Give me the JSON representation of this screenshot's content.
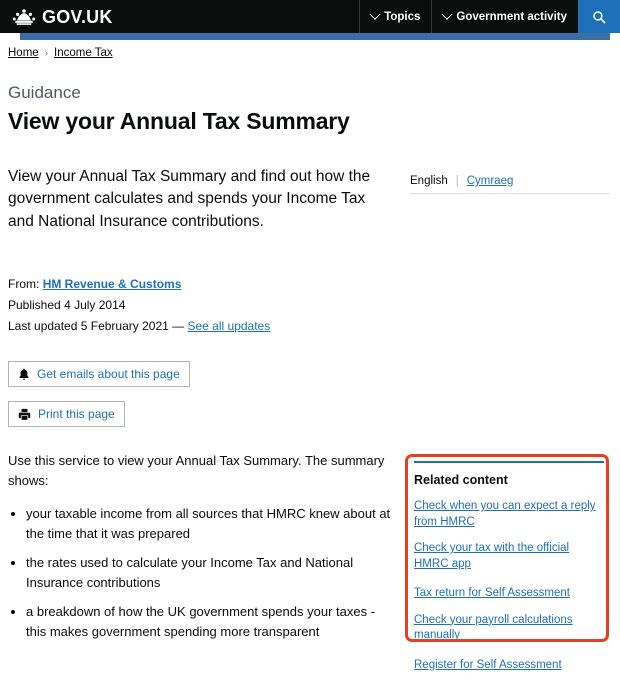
{
  "header": {
    "brand": "GOV.UK",
    "crown_icon": "crown-icon",
    "nav": [
      {
        "label": "Topics",
        "icon": "chevron-down-icon"
      },
      {
        "label": "Government activity",
        "icon": "chevron-down-icon"
      }
    ],
    "search_icon": "search-icon"
  },
  "breadcrumb": {
    "items": [
      "Home",
      "Income Tax"
    ],
    "separator": "›"
  },
  "language": {
    "current": "English",
    "separator": "|",
    "alternate": "Cymraeg"
  },
  "page": {
    "label": "Guidance",
    "title": "View your Annual Tax Summary",
    "lead": "View your Annual Tax Summary and find out how the government calculates and spends your Income Tax and National Insurance contributions."
  },
  "metadata": {
    "from_label": "From:",
    "from_value": "HM Revenue & Customs",
    "published_label": "Published",
    "published_value": "4 July 2014",
    "updated_label": "Last updated",
    "updated_value": "5 February 2021",
    "updated_dash": "—",
    "updates_link": "See all updates"
  },
  "actions": {
    "emails": {
      "label": "Get emails about this page",
      "icon": "bell-icon"
    },
    "print": {
      "label": "Print this page",
      "icon": "printer-icon"
    }
  },
  "content": {
    "intro": "Use this service to view your Annual Tax Summary. The summary shows:",
    "bullets": [
      "your taxable income from all sources that HMRC knew about at the time that it was prepared",
      "the rates used to calculate your Income Tax and National Insurance contributions",
      "a breakdown of how the UK government spends your taxes - this makes government spending more transparent"
    ]
  },
  "related": {
    "title": "Related content",
    "links": [
      "Check when you can expect a reply from HMRC",
      "Check your tax with the official HMRC app",
      "Tax return for Self Assessment",
      "Check your payroll calculations manually",
      "Register for Self Assessment"
    ]
  },
  "colors": {
    "header_bg": "#0b0c0c",
    "link_blue": "#1d70b8",
    "blue_bar": "#3a6ea8",
    "highlight_red": "#e5401f",
    "muted_text": "#505a5f",
    "button_border": "#b1b4b6"
  }
}
